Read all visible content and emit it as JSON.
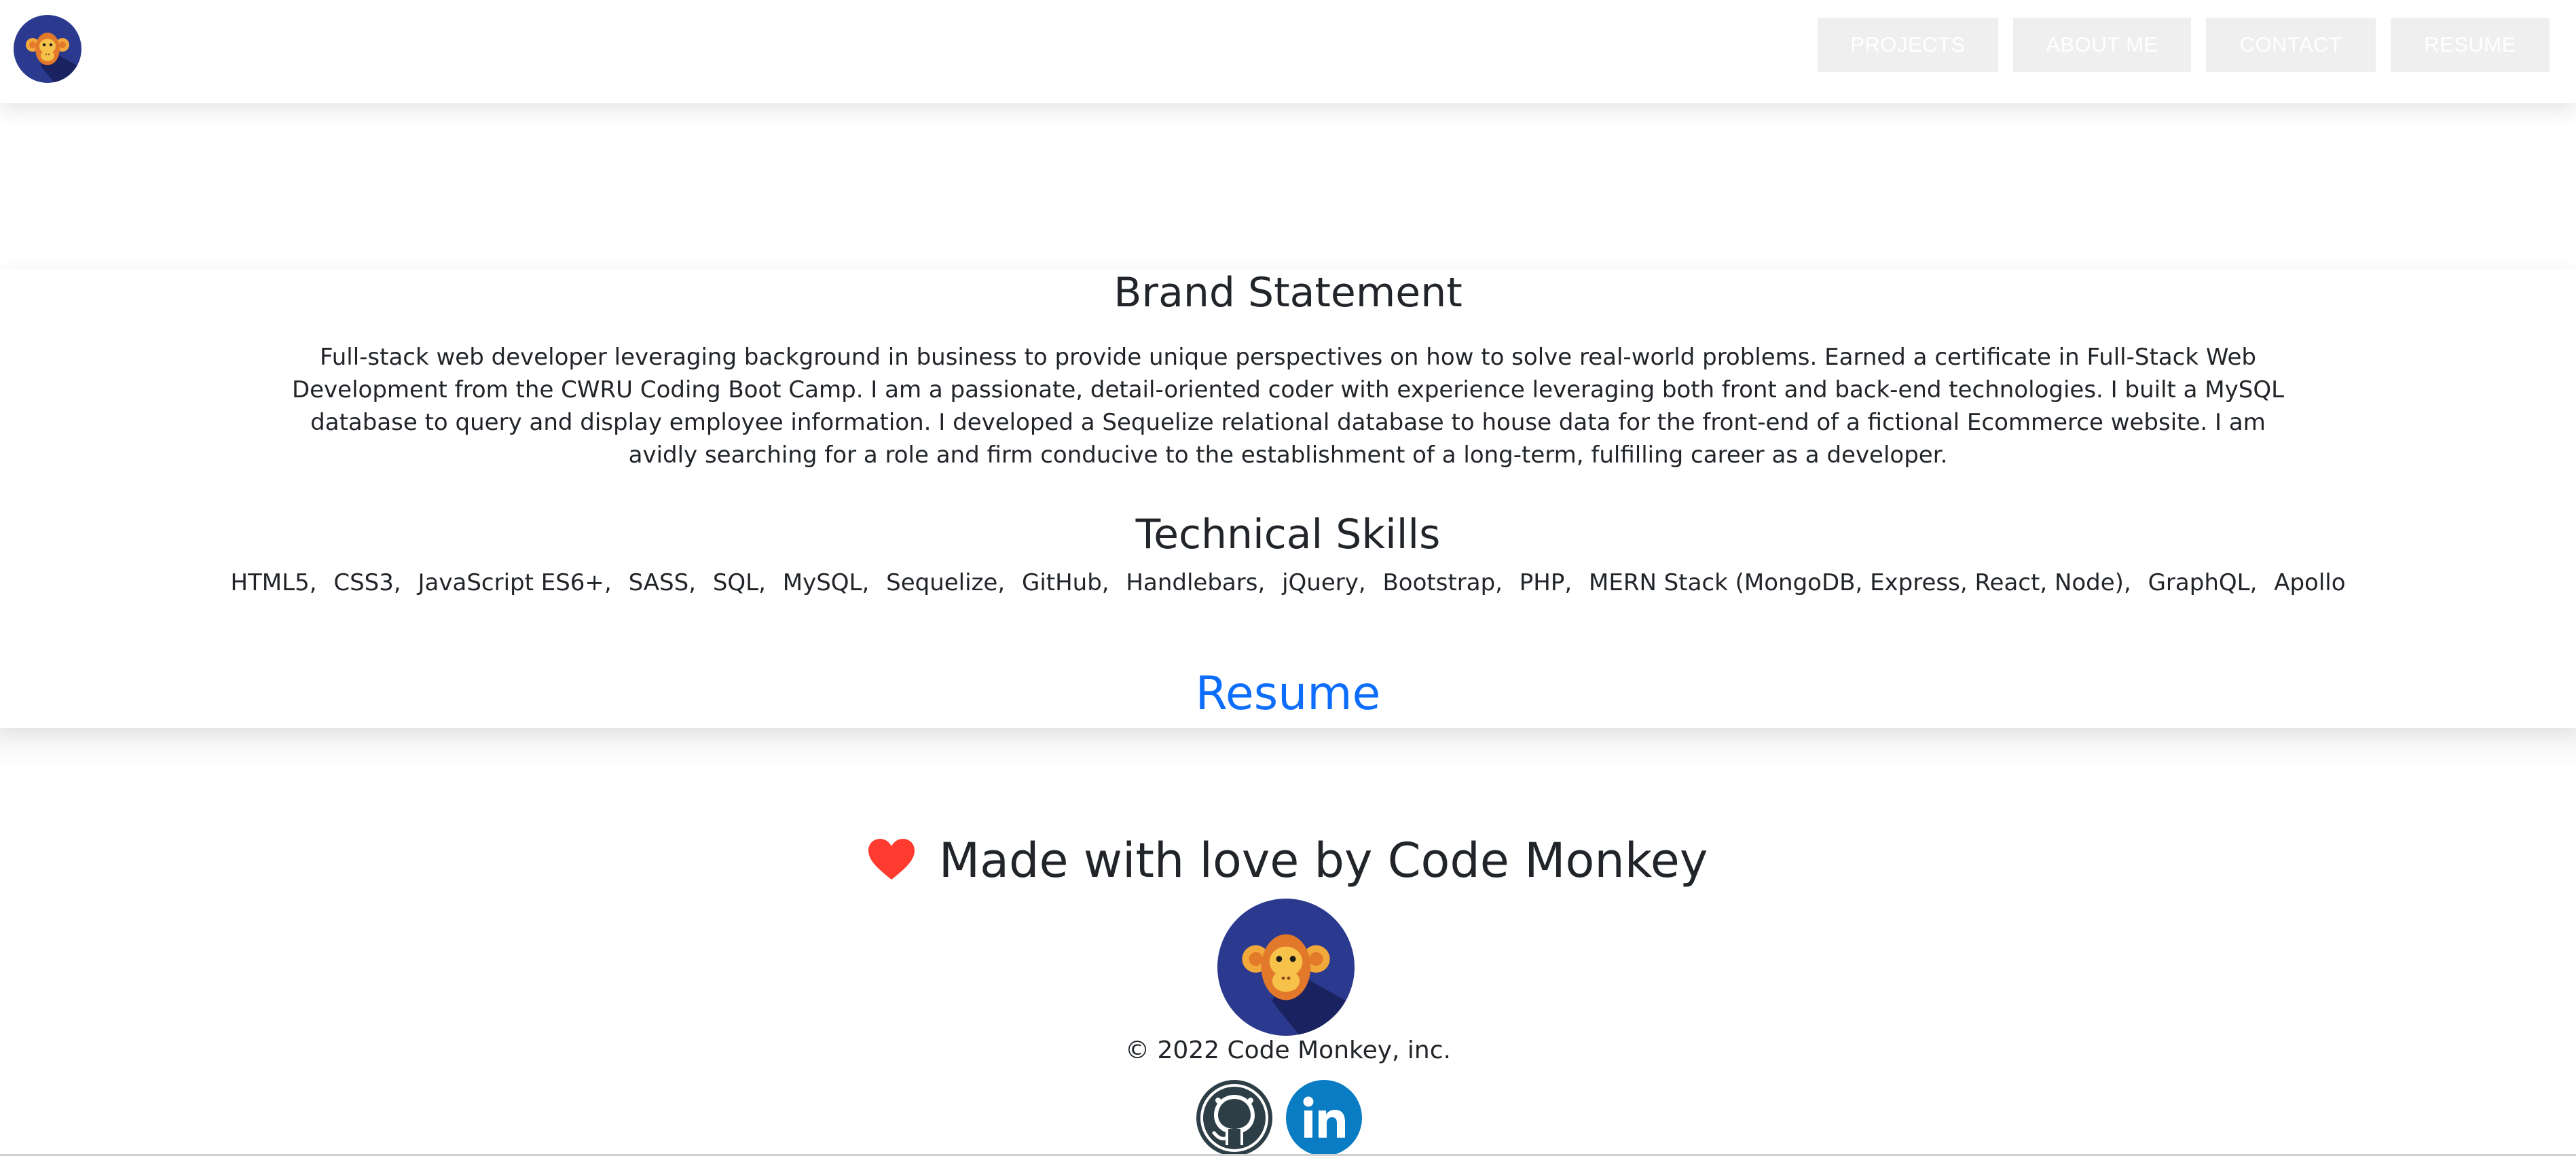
{
  "header": {
    "logo_alt": "Code Monkey logo",
    "nav": [
      {
        "label": "PROJECTS"
      },
      {
        "label": "ABOUT ME"
      },
      {
        "label": "CONTACT"
      },
      {
        "label": "RESUME"
      }
    ]
  },
  "main": {
    "brand_title": "Brand Statement",
    "brand_text": "Full-stack web developer leveraging background in business to provide unique perspectives on how to solve real-world problems. Earned a certificate in Full-Stack Web Development from the CWRU Coding Boot Camp. I am a passionate, detail-oriented coder with experience leveraging both front and back-end technologies. I built a MySQL database to query and display employee information. I developed a Sequelize relational database to house data for the front-end of a fictional Ecommerce website. I am avidly searching for a role and firm conducive to the establishment of a long-term, fulfilling career as a developer.",
    "skills_title": "Technical Skills",
    "skills": [
      "HTML5",
      "CSS3",
      "JavaScript ES6+",
      "SASS",
      "SQL",
      "MySQL",
      "Sequelize",
      "GitHub",
      "Handlebars",
      "jQuery",
      "Bootstrap",
      "PHP",
      "MERN Stack (MongoDB, Express, React, Node)",
      "GraphQL",
      "Apollo"
    ],
    "resume_link": "Resume"
  },
  "footer": {
    "title": "Made with love by Code Monkey",
    "copyright": "© 2022 Code Monkey, inc.",
    "social": [
      {
        "icon": "github-icon"
      },
      {
        "icon": "linkedin-icon"
      }
    ]
  },
  "colors": {
    "link": "#0d6efd",
    "heart": "#ff3b30",
    "logo_bg": "#2b3a8f",
    "nav_bg": "#efefef",
    "github": "#2d3e46",
    "linkedin": "#0a7cc4"
  }
}
